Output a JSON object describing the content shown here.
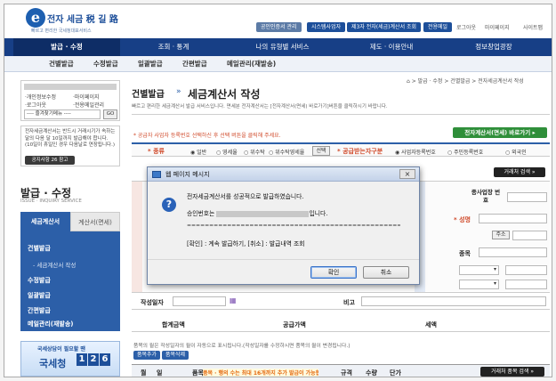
{
  "header": {
    "logo_letter": "e",
    "logo_text": "전자 세금 税 길 路",
    "logo_sub": "빠르고 편리한 국세청대표서비스",
    "utility_buttons": [
      "공인인증서 관리",
      "시스템사업자",
      "제3자 전자(세금)계산서 조회",
      "전용메일"
    ],
    "top_links": [
      "로그아웃",
      "마이페이지",
      "사이트맵"
    ]
  },
  "main_nav": [
    "발급 · 수정",
    "조회 · 통계",
    "나의 유형별 서비스",
    "제도 · 이용안내",
    "정보창업광장"
  ],
  "sub_nav": [
    "건별발급",
    "수정발급",
    "일괄발급",
    "간편발급",
    "메일관리(재발송)"
  ],
  "sidebar": {
    "links": [
      "·개인정보수정",
      "·마이페이지",
      "·로그아웃",
      "·전용메일관리"
    ],
    "favorites_select": "---- 즐겨찾기메뉴 ----",
    "go_label": "GO",
    "notice_text": "전자세금계산서는 반드시 거래시기가 속하는 달의 다음 달 10일까지 발급해야 합니다. (10일이 휴일인 경우 다음날로 연장됩니다.)",
    "notice_button": "공지사항 26 참고",
    "section_title": "발급 · 수정",
    "section_sub": "ISSUE · INQUIRY SERVICE",
    "tabs": [
      "세금계산서",
      "계산서(면세)"
    ],
    "menu": [
      {
        "label": "건별발급",
        "sub": false
      },
      {
        "label": "- 세금계산서 작성",
        "sub": true
      },
      {
        "label": "수정발급",
        "sub": false
      },
      {
        "label": "일괄발급",
        "sub": false
      },
      {
        "label": "간편발급",
        "sub": false
      },
      {
        "label": "메일관리(재발송)",
        "sub": false
      }
    ],
    "promo_line1": "국세상담이 필요할 땐",
    "promo_brand": "국세청",
    "promo_digits": [
      "1",
      "2",
      "6"
    ]
  },
  "content": {
    "breadcrumb": "⌂ > 발급 · 수정 > 건별발급 > 전자세금계산서 작성",
    "title_prefix": "건별발급",
    "title_sep": "»",
    "title": "세금계산서 작성",
    "note": "빠르고 편리한 세금계산서 발급 서비스입니다. 면세분 전자계산서는 [전자계산서(면세) 바로가기]버튼을 클릭하시기 바랍니다.",
    "green_button": "전자계산서(면세) 바로가기 ▸",
    "red_note": "* 공급자 사업자 등록번호 선택하신 후 선택 버튼을 클릭해 주세요.",
    "type_label": "* 종류",
    "type_options": [
      "일반",
      "영세율",
      "위수탁",
      "위수탁영세율"
    ],
    "select_btn": "선택",
    "recipient_label": "* 공급받는자구분",
    "recipient_options": [
      "사업자등록번호",
      "주민등록번호",
      "외국인"
    ],
    "partner_btn": "거래처 검색 »",
    "field_labels": [
      "종사업장 번호",
      "* 성명",
      "주소",
      "종목"
    ],
    "date_label": "작성일자",
    "memo_label": "비고",
    "sum_headers": [
      "합계금액",
      "공급가액",
      "세액"
    ],
    "bottom_note": "품목의 월은 작성일자의 월이 자동으로 표시됩니다.(작성일자를 수정하시면 품목의 월이 변경됩니다.)",
    "item_buttons": [
      "품목추가",
      "품목삭제"
    ],
    "table_headers": [
      "월",
      "일",
      "품목",
      "규격",
      "수량",
      "단가"
    ],
    "marquee": "품목 · 행의 수는 최대 16개까지 추가 발급이 가능합니다",
    "partner_btn2": "거래처 품목 검색 »"
  },
  "dialog": {
    "title": "웹 페이지 메시지",
    "message1": "전자세금계산서를 성공적으로 발급하였습니다.",
    "approval_prefix": "승인번호는 ",
    "approval_suffix": "입니다.",
    "separator": "====================================================",
    "options": "[확인] : 계속 발급하기, [취소] : 발급내역 조회",
    "ok_label": "확인",
    "cancel_label": "취소",
    "close_symbol": "×"
  },
  "colors": {
    "nav": "#173f86",
    "accent_blue": "#2c5fa8",
    "green": "#2f8f3a",
    "red": "#d04a2a"
  }
}
